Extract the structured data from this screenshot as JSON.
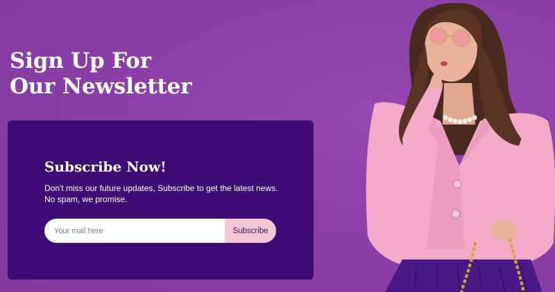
{
  "headline": {
    "line1": "Sign Up For",
    "line2": "Our Newsletter"
  },
  "card": {
    "title": "Subscribe Now!",
    "description_line1": "Don't miss our future updates, Subscribe to get the latest news.",
    "description_line2": "No spam, we promise."
  },
  "form": {
    "email_value": "",
    "email_placeholder": "Your mail here",
    "button_label": "Subscribe"
  },
  "colors": {
    "background": "#8a3fa6",
    "card": "#3f0c75",
    "button": "#f5c7d4",
    "jacket": "#f3a9c8",
    "skirt": "#4a1a86"
  }
}
